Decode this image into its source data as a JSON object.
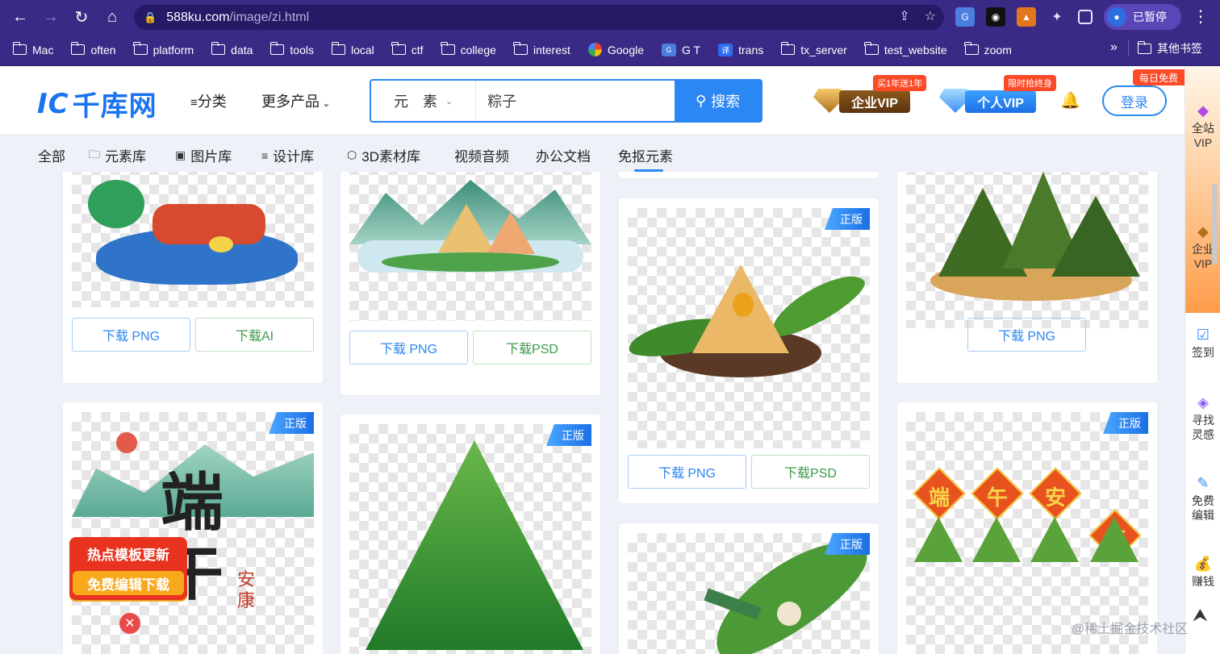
{
  "browser": {
    "url_host": "588ku.com",
    "url_path": "/image/zi.html",
    "profile_label": "已暂停",
    "bookmarks": [
      "Mac",
      "often",
      "platform",
      "data",
      "tools",
      "local",
      "ctf",
      "college",
      "interest",
      "Google",
      "G T",
      "trans",
      "tx_server",
      "test_website",
      "zoom"
    ],
    "bookmarks_more": "»",
    "other_bookmarks": "其他书签"
  },
  "header": {
    "logo_text": "千库网",
    "nav": [
      "分类",
      "更多产品"
    ],
    "search_type": "元　素",
    "search_value": "粽子",
    "search_button": "搜索",
    "vip_enterprise": "企业VIP",
    "vip_enterprise_promo": "买1年送1年",
    "vip_personal": "个人VIP",
    "vip_personal_promo": "限时抢终身",
    "login": "登录",
    "daily_free": "每日免费"
  },
  "categories": [
    "全部",
    "元素库",
    "图片库",
    "设计库",
    "3D素材库",
    "视频音频",
    "办公文档",
    "免抠元素"
  ],
  "cards": {
    "download_png": "下载 PNG",
    "download_ai": "下载AI",
    "download_psd": "下载PSD",
    "genuine_tag": "正版",
    "promo_line1": "热点模板更新",
    "promo_line2": "免费编辑下载",
    "poster_chars": [
      "端",
      "午",
      "安",
      "康"
    ],
    "title_tiles": [
      "端",
      "午",
      "安",
      "康"
    ]
  },
  "sidebar": {
    "items": [
      "全站\nVIP",
      "企业\nVIP",
      "签到",
      "寻找\n灵感",
      "免费\n编辑",
      "赚钱"
    ]
  },
  "watermark": "@稀土掘金技术社区",
  "colors": {
    "brand": "#2b87f3",
    "chrome": "#3a2a86",
    "promo": "#ff4a28"
  }
}
